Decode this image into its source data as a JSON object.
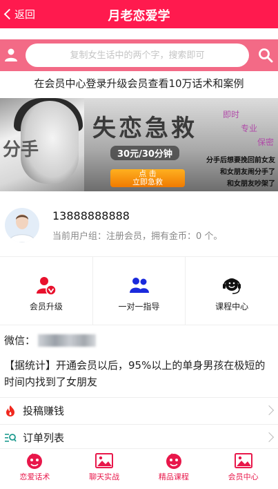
{
  "header": {
    "back_label": "返回",
    "title": "月老恋爱学"
  },
  "search": {
    "placeholder": "复制女生话中的两个字，搜索即可"
  },
  "notice": "在会员中心登录升级会员查看10万话术和案例",
  "banner": {
    "title": "失恋急救",
    "side_text": "分手",
    "tags": [
      "即时",
      "专业",
      "保密"
    ],
    "price": "30元/30分钟",
    "cta_top": "点  击",
    "cta_bottom": "立即急救",
    "lines": [
      "分手后想要挽回前女友",
      "和女朋友闹分手了",
      "和女朋友吵架了"
    ]
  },
  "profile": {
    "phone": "13888888888",
    "group_text": "当前用户组：注册会员，拥有金币：0 个。"
  },
  "grid": [
    {
      "label": "会员升级",
      "icon": "member-upgrade-icon"
    },
    {
      "label": "一对一指导",
      "icon": "people-icon"
    },
    {
      "label": "课程中心",
      "icon": "headset-icon"
    }
  ],
  "wechat_label": "微信：",
  "stat_text": "【据统计】开通会员以后，95%以上的单身男孩在极短的时间内找到了女朋友",
  "menu": [
    {
      "label": "投稿赚钱",
      "icon": "fire-icon"
    },
    {
      "label": "订单列表",
      "icon": "list-search-icon"
    }
  ],
  "tabs": [
    {
      "label": "恋爱话术",
      "icon": "cupid-icon"
    },
    {
      "label": "聊天实战",
      "icon": "image-icon"
    },
    {
      "label": "精品课程",
      "icon": "cupid-icon"
    },
    {
      "label": "会员中心",
      "icon": "image-icon"
    }
  ],
  "colors": {
    "primary": "#ff1a4e",
    "search_bar": "#f36a86",
    "tab_text": "#e8174a"
  }
}
